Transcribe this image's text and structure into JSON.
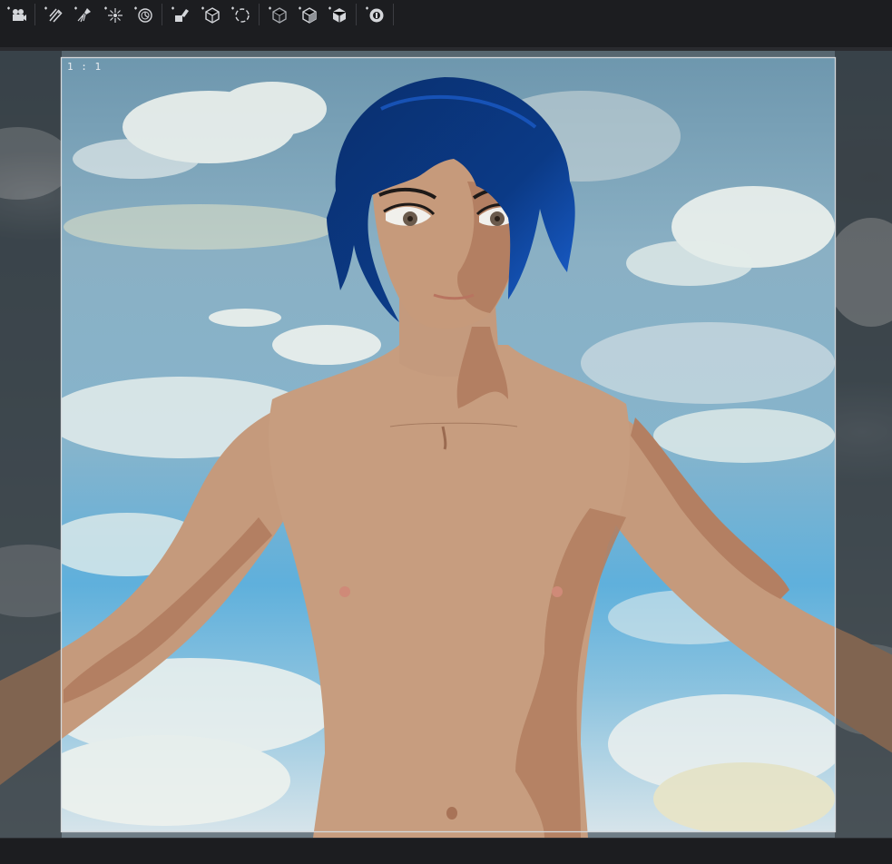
{
  "toolbar": {
    "tools": [
      {
        "name": "add-camera-icon"
      },
      {
        "name": "add-directional-light-icon"
      },
      {
        "name": "add-spot-light-icon"
      },
      {
        "name": "add-point-light-icon"
      },
      {
        "name": "add-sun-dial-icon"
      },
      {
        "name": "add-paint-tool-icon"
      },
      {
        "name": "add-cube-icon"
      },
      {
        "name": "add-sphere-wire-icon"
      },
      {
        "name": "add-box-outline-icon"
      },
      {
        "name": "add-box-split-icon"
      },
      {
        "name": "add-box-solid-icon"
      },
      {
        "name": "add-environment-icon"
      }
    ]
  },
  "viewport": {
    "ratio_label": "1 : 1"
  },
  "colors": {
    "toolbar_bg": "#1c1d20",
    "icon": "#d4d6da",
    "skin": "#c69a7b",
    "skin_shadow": "#b78163",
    "hair": "#0d3b86",
    "hair_highlight": "#1c5fd0",
    "sky": "#8fb9cf"
  }
}
